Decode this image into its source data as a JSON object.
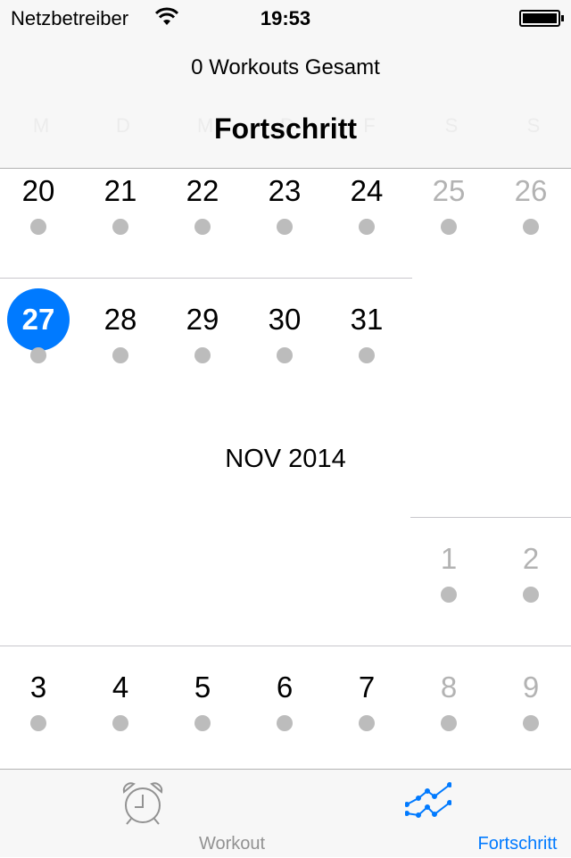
{
  "status_bar": {
    "carrier": "Netzbetreiber",
    "time": "19:53",
    "battery_level": 1.0
  },
  "nav": {
    "subtitle": "0 Workouts Gesamt",
    "title": "Fortschritt",
    "weekdays": [
      "M",
      "D",
      "M",
      "D",
      "F",
      "S",
      "S"
    ]
  },
  "calendar": {
    "week1": [
      {
        "d": "20"
      },
      {
        "d": "21"
      },
      {
        "d": "22"
      },
      {
        "d": "23"
      },
      {
        "d": "24"
      },
      {
        "d": "25",
        "muted": true
      },
      {
        "d": "26",
        "muted": true
      }
    ],
    "week2": [
      {
        "d": "27",
        "today": true
      },
      {
        "d": "28"
      },
      {
        "d": "29"
      },
      {
        "d": "30"
      },
      {
        "d": "31"
      }
    ],
    "month_label": "NOV 2014",
    "week3": [
      {
        "d": "1",
        "muted": true,
        "col": 5
      },
      {
        "d": "2",
        "muted": true,
        "col": 6
      }
    ],
    "week4": [
      {
        "d": "3"
      },
      {
        "d": "4"
      },
      {
        "d": "5"
      },
      {
        "d": "6"
      },
      {
        "d": "7"
      },
      {
        "d": "8",
        "muted": true
      },
      {
        "d": "9",
        "muted": true
      }
    ]
  },
  "tabbar": {
    "tabs": [
      {
        "label": "Workout",
        "icon": "alarm-clock-icon",
        "selected": false
      },
      {
        "label": "Fortschritt",
        "icon": "progress-chart-icon",
        "selected": true
      }
    ]
  },
  "colors": {
    "accent": "#007aff",
    "inactive": "#929292"
  }
}
